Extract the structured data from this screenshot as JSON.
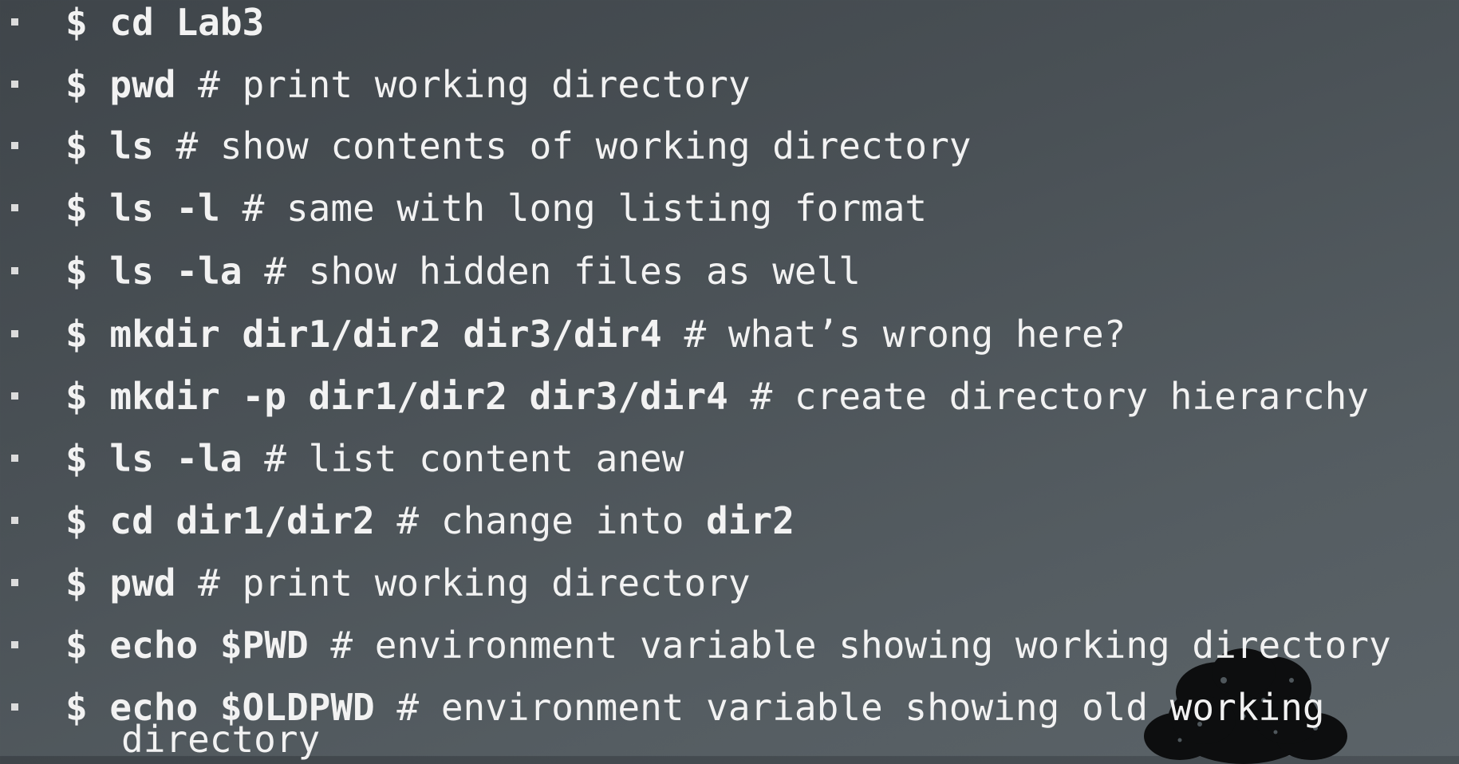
{
  "lines": [
    {
      "cmd": "$ cd Lab3",
      "comment": ""
    },
    {
      "cmd": "$ pwd",
      "comment": " # print working directory"
    },
    {
      "cmd": "$ ls",
      "comment": " # show contents of working directory"
    },
    {
      "cmd": "$ ls -l",
      "comment": " # same with long listing format"
    },
    {
      "cmd": "$ ls -la",
      "comment": " # show hidden files as well"
    },
    {
      "cmd": "$ mkdir dir1/dir2 dir3/dir4",
      "comment": " # what’s wrong here?"
    },
    {
      "cmd": "$ mkdir -p dir1/dir2 dir3/dir4",
      "comment": " # create directory hierarchy"
    },
    {
      "cmd": "$ ls -la",
      "comment": " # list content anew"
    },
    {
      "cmd": "$ cd dir1/dir2",
      "comment": " # change into ",
      "tail_bold": "dir2"
    },
    {
      "cmd": "$ pwd",
      "comment": " #  print working directory"
    },
    {
      "cmd": "$ echo $PWD",
      "comment": " # environment variable showing working directory"
    },
    {
      "cmd": "$ echo $OLDPWD",
      "comment": " # environment variable showing old working",
      "continuation": "directory"
    }
  ]
}
